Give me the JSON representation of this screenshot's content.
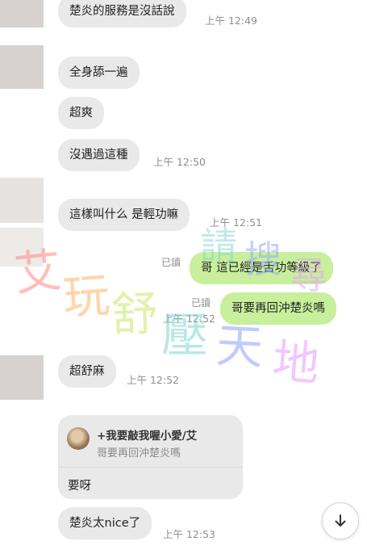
{
  "messages": [
    {
      "text": "楚炎的服務是沒話說",
      "time": "上午 12:49"
    },
    {
      "text": "全身舔一遍"
    },
    {
      "text": "超爽"
    },
    {
      "text": "沒遇過這種",
      "time": "上午 12:50"
    },
    {
      "text": "這樣叫什么 是輕功嘛",
      "time": "上午 12:51"
    },
    {
      "text": "哥 這已經是舌功等級了",
      "read": "已讀"
    },
    {
      "text": "哥要再回沖楚炎嗎",
      "read": "已讀",
      "time": "上午 12:52"
    },
    {
      "text": "超舒麻",
      "time": "上午 12:52"
    },
    {
      "text": "楚炎太nice了",
      "time": "上午 12:53"
    }
  ],
  "reply": {
    "title": "+我要敲我喔小愛/艾",
    "quoted": "哥要再回沖楚炎嗎",
    "body": "要呀"
  },
  "watermark": {
    "chars": [
      "艾",
      "玩",
      "舒",
      "壓",
      "天",
      "地"
    ],
    "top_chars": [
      "請",
      "搜",
      "尋"
    ],
    "colors": [
      "#ff8a8a",
      "#ffb36b",
      "#c8e86a",
      "#7fd7d0",
      "#8ea2ff",
      "#e89bff"
    ]
  },
  "colors": {
    "received": "#e9e9ea",
    "sent": "#c7ef9c"
  },
  "icons": {
    "scroll_down": "arrow-down-icon"
  }
}
